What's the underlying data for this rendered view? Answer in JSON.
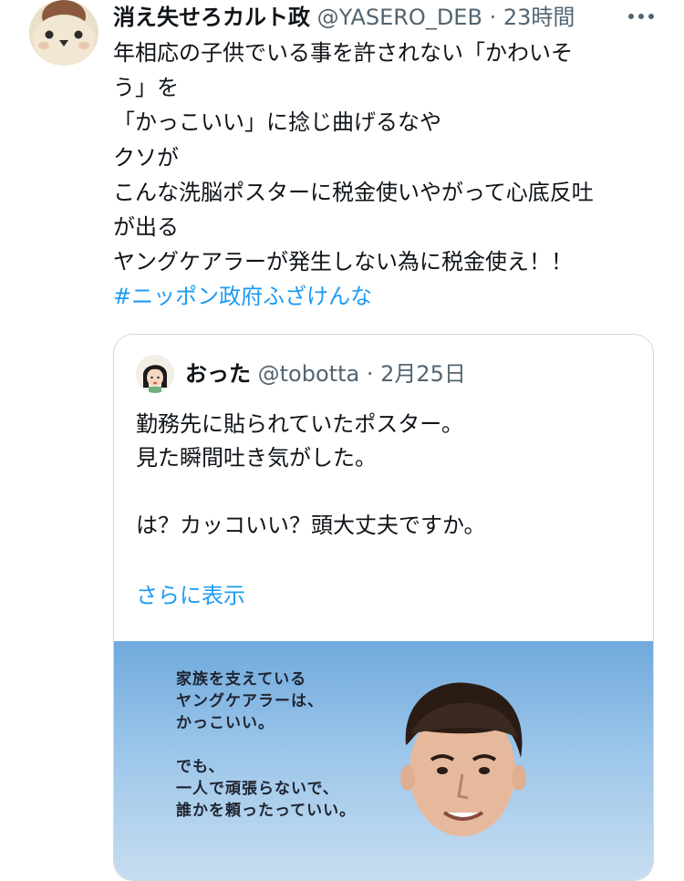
{
  "tweet": {
    "author_name": "消え失せろカルト政",
    "author_handle": "@YASERO_DEB",
    "separator": "·",
    "time": "23時間",
    "body_lines": [
      "年相応の子供でいる事を許されない「かわいそ",
      "う」を",
      "「かっこいい」に捻じ曲げるなや",
      "クソが",
      "こんな洗脳ポスターに税金使いやがって心底反吐",
      "が出る",
      "ヤングケアラーが発生しない為に税金使え！！"
    ],
    "hashtag": "#ニッポン政府ふざけんな"
  },
  "quote": {
    "author_name": "おった",
    "author_handle": "@tobotta",
    "separator": "·",
    "date": "2月25日",
    "body_lines": [
      "勤務先に貼られていたポスター。",
      "見た瞬間吐き気がした。",
      "",
      "は？カッコいい？頭大丈夫ですか。"
    ],
    "show_more": "さらに表示"
  },
  "poster": {
    "text_lines": [
      "家族を支えている",
      "ヤングケアラーは、",
      "かっこいい。",
      "",
      "でも、",
      "一人で頑張らないで、",
      "誰かを頼ったっていい。"
    ]
  },
  "icons": {
    "avatar": "bird-avatar-icon",
    "more": "more-horizontal-icon",
    "quote_avatar": "girl-avatar-icon"
  },
  "colors": {
    "link": "#1d9bf0",
    "secondary_text": "#536471",
    "border": "#cfd9de"
  }
}
